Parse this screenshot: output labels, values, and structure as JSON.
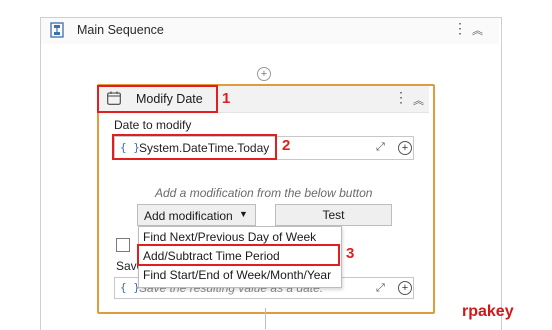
{
  "sequence": {
    "title": "Main Sequence",
    "more_icon": "⋮",
    "collapse_icon": "︽"
  },
  "activity": {
    "title": "Modify Date",
    "more_icon": "⋮",
    "collapse_icon": "︽",
    "date_label": "Date to modify",
    "date_value": "System.DateTime.Today",
    "brace": "{ }",
    "hint": "Add a modification from the below button",
    "add_button": "Add modification",
    "test_button": "Test",
    "save_label_partial": "Save",
    "save_placeholder": "Save the resulting value as a date."
  },
  "menu": {
    "items": [
      "Find Next/Previous Day of Week",
      "Add/Subtract Time Period",
      "Find Start/End of Week/Month/Year"
    ]
  },
  "annotations": {
    "one": "1",
    "two": "2",
    "three": "3"
  },
  "brand": "rpakey",
  "colors": {
    "accent_border": "#e19a3c",
    "annotation_red": "#e02020",
    "brace_blue": "#3a6fb0"
  }
}
